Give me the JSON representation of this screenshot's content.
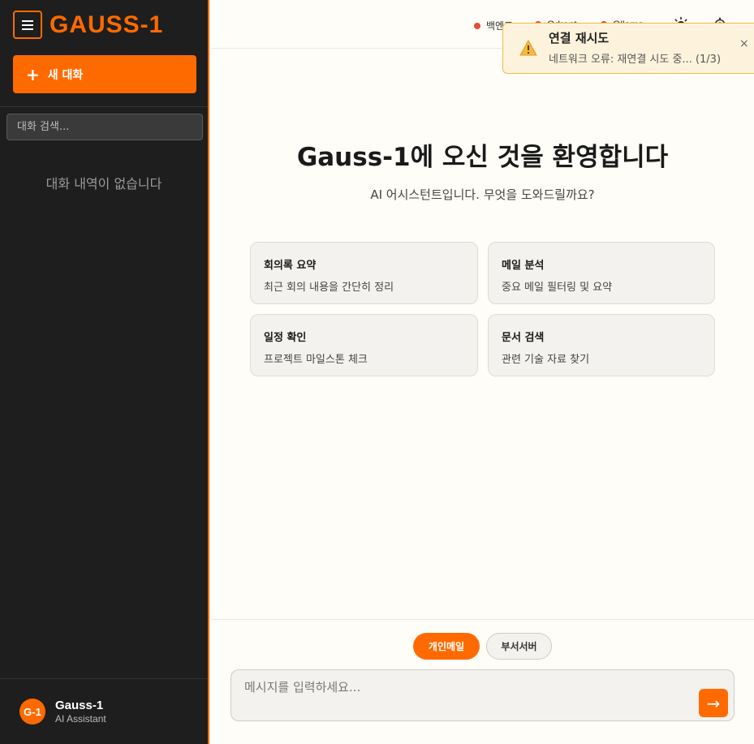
{
  "sidebar": {
    "brand": "GAUSS-1",
    "new_chat_label": "새 대화",
    "search_placeholder": "대화 검색...",
    "empty_history": "대화 내역이 없습니다",
    "user": {
      "avatar_initials": "G-1",
      "name": "Gauss-1",
      "subtitle": "AI Assistant"
    }
  },
  "topbar": {
    "statuses": [
      {
        "label": "백엔드",
        "color": "#e84a3a"
      },
      {
        "label": "Qdrant",
        "color": "#e84a3a"
      },
      {
        "label": "Ollama",
        "color": "#e84a3a"
      }
    ],
    "icons": [
      "sun-icon",
      "gear-icon"
    ]
  },
  "toast": {
    "title": "연결 재시도",
    "message": "네트워크 오류: 재연결 시도 중... (1/3)",
    "close": "×"
  },
  "main": {
    "title": "Gauss-1에 오신 것을 환영합니다",
    "subtitle": "AI 어시스턴트입니다. 무엇을 도와드릴까요?",
    "cards": [
      {
        "title": "회의록 요약",
        "desc": "최근 회의 내용을 간단히 정리"
      },
      {
        "title": "메일 분석",
        "desc": "중요 메일 필터링 및 요약"
      },
      {
        "title": "일정 확인",
        "desc": "프로젝트 마일스톤 체크"
      },
      {
        "title": "문서 검색",
        "desc": "관련 기술 자료 찾기"
      }
    ]
  },
  "composer": {
    "chips": [
      {
        "label": "개인메일",
        "active": true
      },
      {
        "label": "부서서버",
        "active": false
      }
    ],
    "placeholder": "메시지를 입력하세요...",
    "send_icon": "→"
  },
  "colors": {
    "accent": "#ff6a00",
    "sidebar_bg": "#1e1e1e",
    "error_dot": "#e84a3a",
    "toast_bg": "#fdf3dc"
  }
}
